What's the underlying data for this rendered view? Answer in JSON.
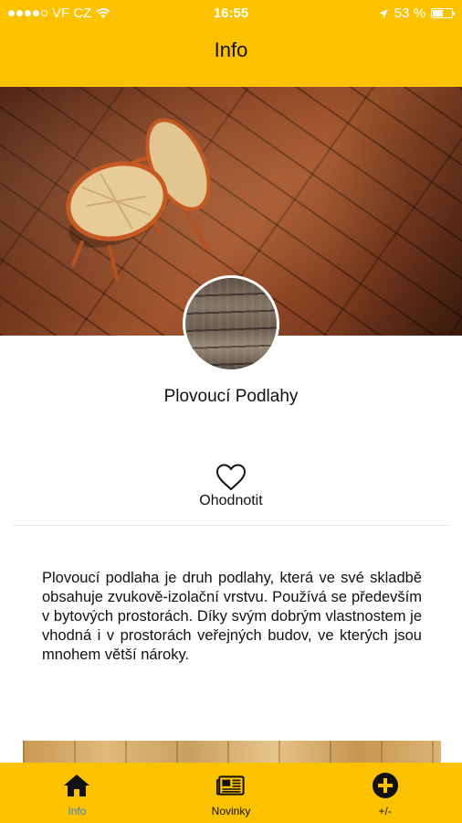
{
  "status_bar": {
    "carrier": "VF CZ",
    "time": "16:55",
    "battery": "53 %",
    "battery_level": 0.53
  },
  "header": {
    "title": "Info"
  },
  "profile": {
    "name": "Plovoucí Podlahy",
    "rate_label": "Ohodnotit"
  },
  "description": "Plovoucí podlaha je druh podlahy, která ve své skladbě obsahuje zvukově-izolační vrstvu. Používá se především v bytových prostorách. Díky svým dobrým vlastnostem je vhodná i v prostorách veřejných budov, ve kterých jsou mnohem větší nároky.",
  "tabs": [
    {
      "label": "Info",
      "icon": "home-icon",
      "active": true
    },
    {
      "label": "Novinky",
      "icon": "newspaper-icon",
      "active": false
    },
    {
      "label": "+/-",
      "icon": "plus-circle-icon",
      "active": false
    }
  ],
  "colors": {
    "accent": "#fcc200",
    "active_tab": "#3c7fd6"
  }
}
